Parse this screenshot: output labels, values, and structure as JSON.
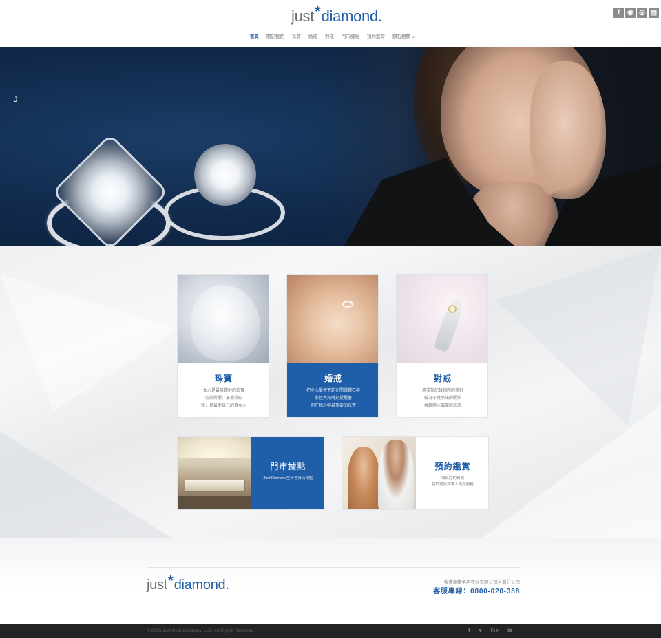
{
  "header": {
    "logo": {
      "part1": "just",
      "star": "*",
      "part2": "diamond",
      "dot": "."
    },
    "social_icons": [
      {
        "icon": "facebook-icon",
        "glyph": "f"
      },
      {
        "icon": "line-icon",
        "glyph": "◉"
      },
      {
        "icon": "instagram-icon",
        "glyph": "◎"
      },
      {
        "icon": "blog-icon",
        "glyph": "▤"
      }
    ],
    "nav": [
      "首頁",
      "關於我們",
      "珠寶",
      "婚戒",
      "對戒",
      "門市據點",
      "預約鑑賞",
      "鑽石相關 ⌄"
    ]
  },
  "hero": {
    "mark": "J",
    "slides": 3,
    "active_slide": 0
  },
  "cards": [
    {
      "title": "珠寶",
      "lines": [
        "女人是最吸鑽射的珍寶",
        "忠於所愛、享受精彩",
        "我，是最愛自己的真女人"
      ],
      "style": "white"
    },
    {
      "title": "婚戒",
      "lines": [
        "把全心愛意寄託在閃耀鑽石中",
        "永恆大光時刻提醒著",
        "你在我心中最重要的位置"
      ],
      "style": "blue"
    },
    {
      "title": "對戒",
      "lines": [
        "用戒指記錄相戀的美好",
        "做為守護承諾的開始",
        "共譜兩人璀璨的未來"
      ],
      "style": "white"
    }
  ],
  "wide_cards": [
    {
      "title": "門市據點",
      "lines": [
        "Just Diamond全台各分店地點"
      ],
      "style": "blue"
    },
    {
      "title": "預約鑑賞",
      "lines": [
        "填寫您的資訊",
        "我們將安排專人為您服務"
      ],
      "style": "white"
    }
  ],
  "footer": {
    "logo": {
      "part1": "just",
      "star": "*",
      "part2": "diamond",
      "dot": "."
    },
    "company": "香港商鑽金店亞洲有限公司台灣分公司",
    "hotline": "客服專線：0800-020-388",
    "copyright": "© 2016 Just Gold Company, LLC. All Rights Reserved.",
    "social": [
      {
        "icon": "facebook-icon",
        "glyph": "f"
      },
      {
        "icon": "twitter-icon",
        "glyph": "♥"
      },
      {
        "icon": "google-plus-icon",
        "glyph": "G+"
      },
      {
        "icon": "rss-icon",
        "glyph": "≋"
      }
    ]
  },
  "colors": {
    "brand_blue": "#1f5ea8",
    "footer_bar": "#222324"
  }
}
